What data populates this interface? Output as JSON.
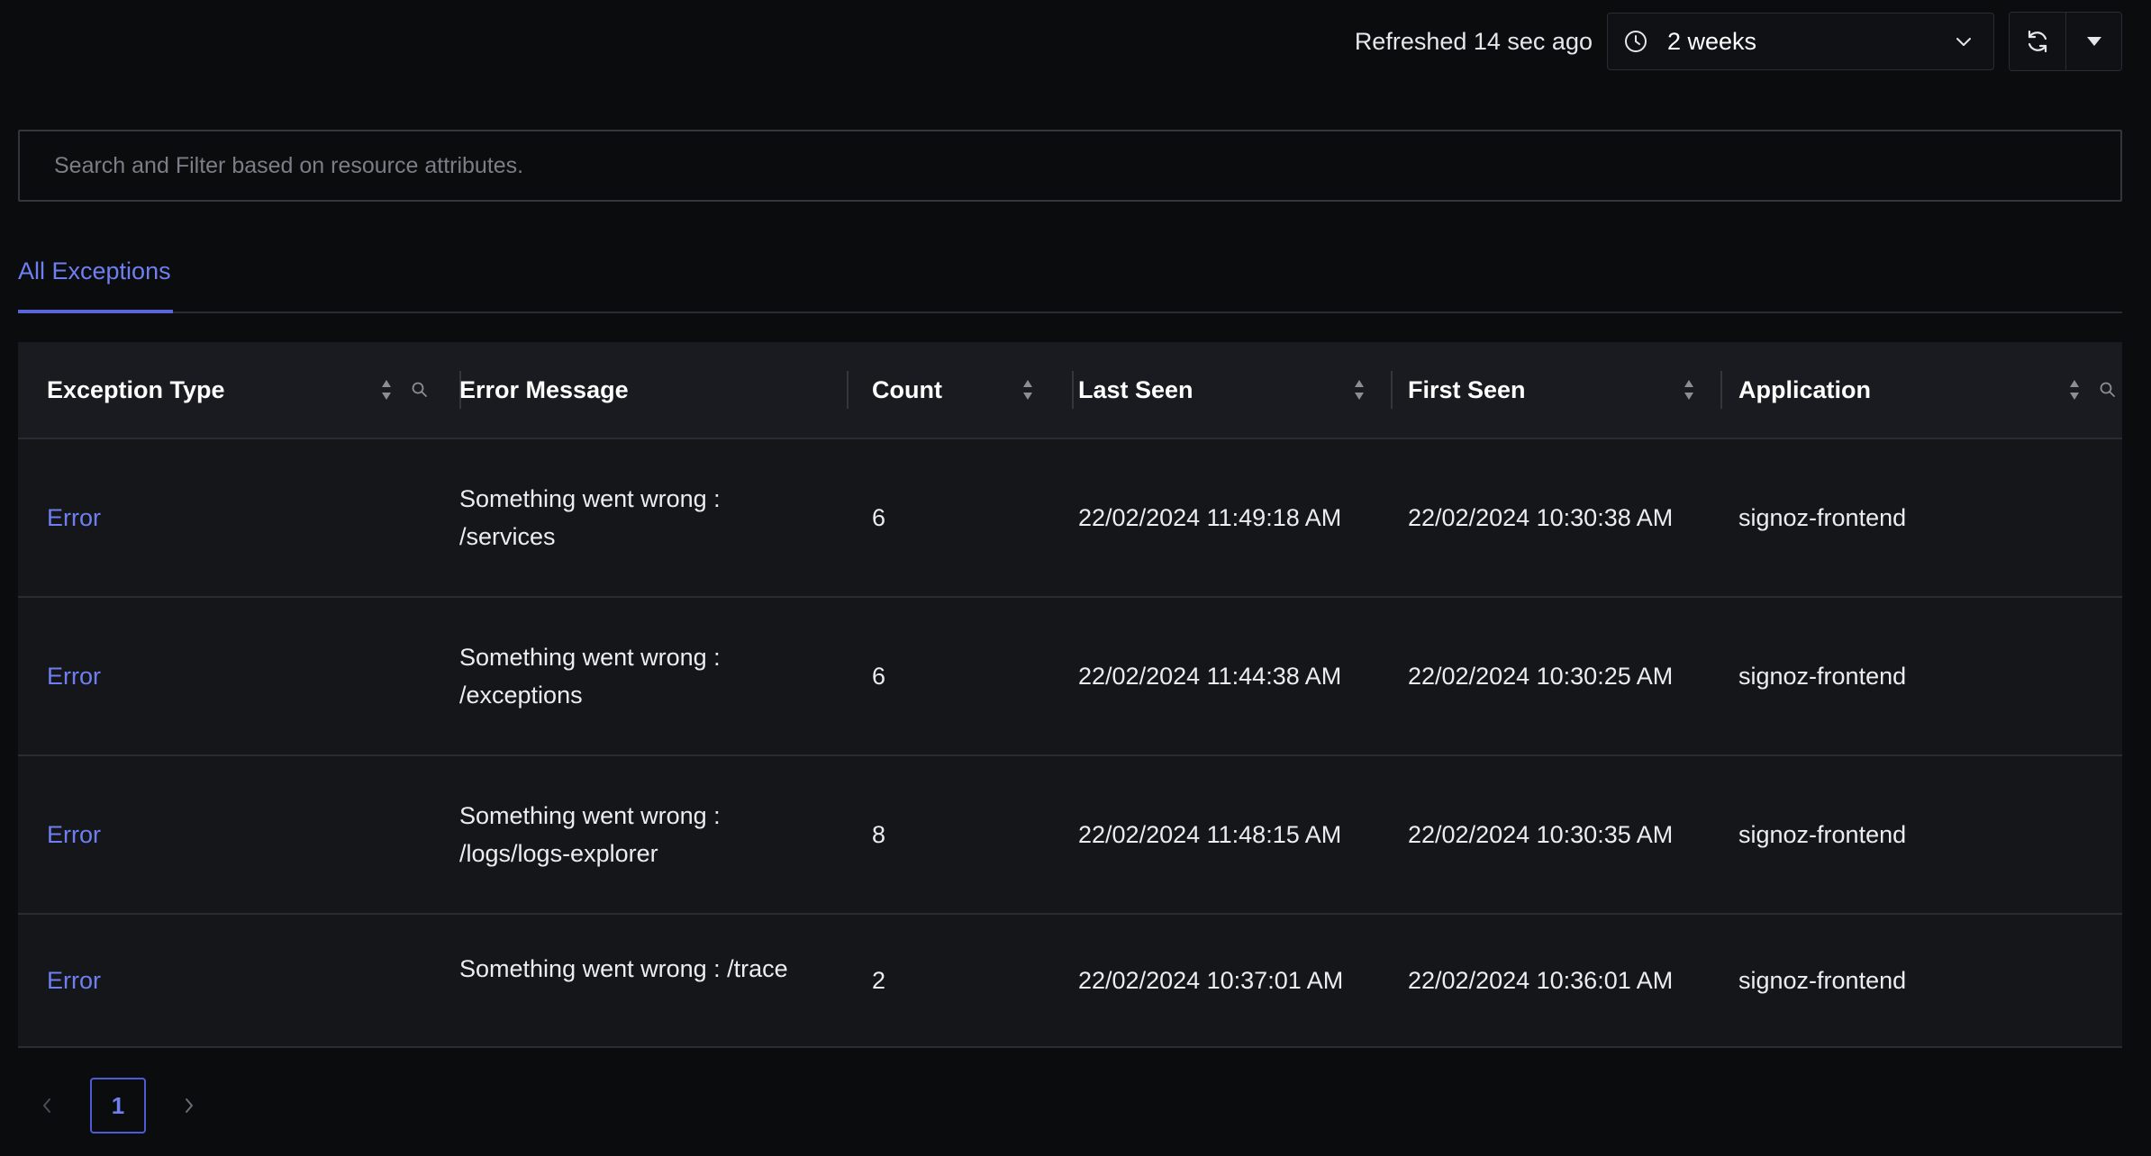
{
  "header": {
    "refreshed_text": "Refreshed 14 sec ago",
    "time_range": "2 weeks"
  },
  "search": {
    "placeholder": "Search and Filter based on resource attributes."
  },
  "tabs": [
    {
      "label": "All Exceptions",
      "active": true
    }
  ],
  "table": {
    "columns": {
      "exception_type": "Exception Type",
      "error_message": "Error Message",
      "count": "Count",
      "last_seen": "Last Seen",
      "first_seen": "First Seen",
      "application": "Application"
    },
    "rows": [
      {
        "exception_type": "Error",
        "error_message": "Something went wrong : /services",
        "count": "6",
        "last_seen": "22/02/2024 11:49:18 AM",
        "first_seen": "22/02/2024 10:30:38 AM",
        "application": "signoz-frontend"
      },
      {
        "exception_type": "Error",
        "error_message": "Something went wrong : /exceptions",
        "count": "6",
        "last_seen": "22/02/2024 11:44:38 AM",
        "first_seen": "22/02/2024 10:30:25 AM",
        "application": "signoz-frontend"
      },
      {
        "exception_type": "Error",
        "error_message": "Something went wrong : /logs/logs-explorer",
        "count": "8",
        "last_seen": "22/02/2024 11:48:15 AM",
        "first_seen": "22/02/2024 10:30:35 AM",
        "application": "signoz-frontend"
      },
      {
        "exception_type": "Error",
        "error_message": "Something went wrong : /trace",
        "count": "2",
        "last_seen": "22/02/2024 10:37:01 AM",
        "first_seen": "22/02/2024 10:36:01 AM",
        "application": "signoz-frontend"
      }
    ]
  },
  "pagination": {
    "current_page": "1"
  },
  "colors": {
    "background": "#0b0c0e",
    "accent": "#6f7ff0",
    "table_bg": "#15161a",
    "border": "#2a2c32"
  }
}
